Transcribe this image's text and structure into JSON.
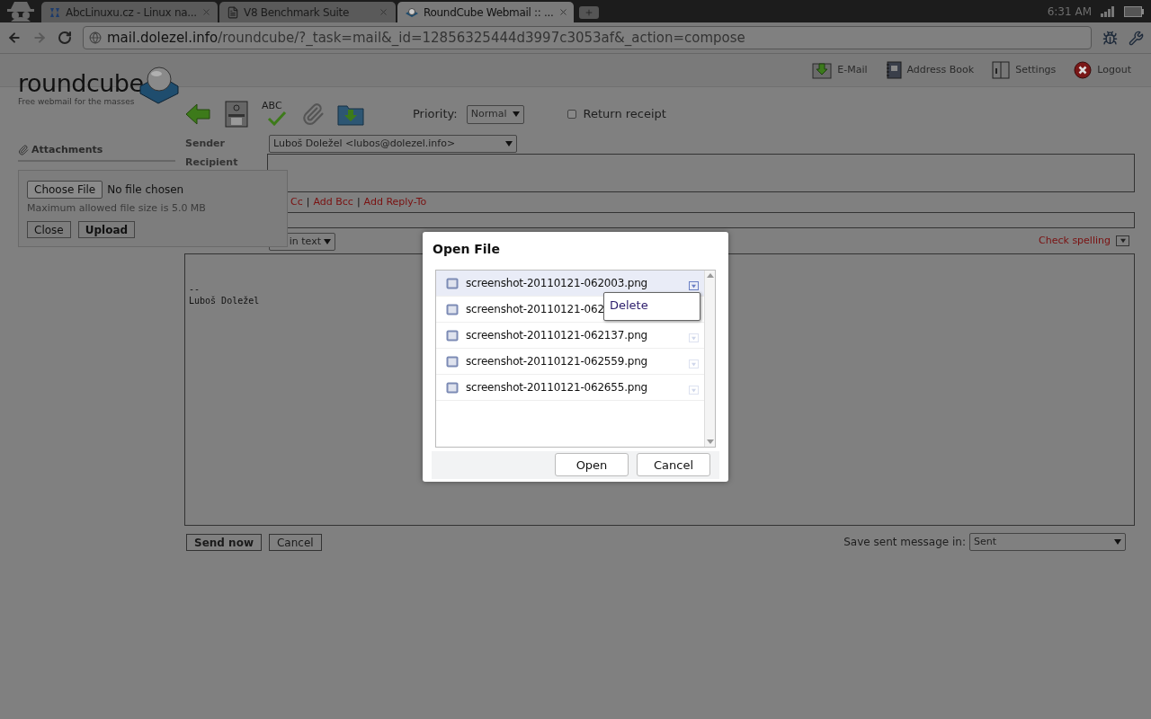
{
  "browser": {
    "tabs": [
      {
        "title": "AbcLinuxu.cz - Linux na...",
        "kind": "site",
        "selected": false
      },
      {
        "title": "V8 Benchmark Suite",
        "kind": "page",
        "selected": false
      },
      {
        "title": "RoundCube Webmail :: ...",
        "kind": "mail",
        "selected": true
      }
    ],
    "url_host": "mail.dolezel.info",
    "url_path": "/roundcube/?_task=mail&_id=12856325444d3997c3053af&_action=compose",
    "clock": "6:31 AM"
  },
  "logo": {
    "name": "roundcube",
    "tagline": "Free webmail for the masses"
  },
  "nav": [
    {
      "label": "E-Mail",
      "kind": "mail"
    },
    {
      "label": "Address Book",
      "kind": "contacts"
    },
    {
      "label": "Settings",
      "kind": "settings"
    },
    {
      "label": "Logout",
      "kind": "logout"
    }
  ],
  "toolbar": {
    "spell_label": "ABC",
    "priority_label": "Priority:",
    "priority": "Normal",
    "return_receipt": {
      "label": "Return receipt",
      "checked": false
    }
  },
  "attachments": {
    "title": "Attachments"
  },
  "upload": {
    "choose_button": "Choose File",
    "file_status": "No file chosen",
    "hint": "Maximum allowed file size is 5.0 MB",
    "buttons": [
      {
        "label": "Close",
        "primary": false
      },
      {
        "label": "Upload",
        "primary": true
      }
    ]
  },
  "compose": {
    "sender_label": "Sender",
    "sender": "Luboš Doležel <lubos@dolezel.info>",
    "recipient_label": "Recipient",
    "header_links": [
      {
        "kind": "link",
        "text": "Cc"
      },
      {
        "kind": "separator",
        "text": "|"
      },
      {
        "kind": "link",
        "text": "Add Bcc"
      },
      {
        "kind": "separator",
        "text": "|"
      },
      {
        "kind": "link",
        "text": "Add Reply-To"
      }
    ],
    "editor_type": "in text",
    "check_spelling": "Check spelling",
    "body": "--\nLuboš Doležel"
  },
  "actions": [
    {
      "label": "Send now",
      "primary": true
    },
    {
      "label": "Cancel",
      "primary": false
    }
  ],
  "save_sent": {
    "label": "Save sent message in:",
    "value": "Sent"
  },
  "dialog": {
    "title": "Open File",
    "files": [
      {
        "name": "screenshot-20110121-062003.png",
        "selected": true
      },
      {
        "name": "screenshot-20110121-062",
        "selected": false
      },
      {
        "name": "screenshot-20110121-062137.png",
        "selected": false
      },
      {
        "name": "screenshot-20110121-062559.png",
        "selected": false
      },
      {
        "name": "screenshot-20110121-062655.png",
        "selected": false
      }
    ],
    "menu": [
      "Delete"
    ],
    "buttons": [
      "Open",
      "Cancel"
    ]
  }
}
